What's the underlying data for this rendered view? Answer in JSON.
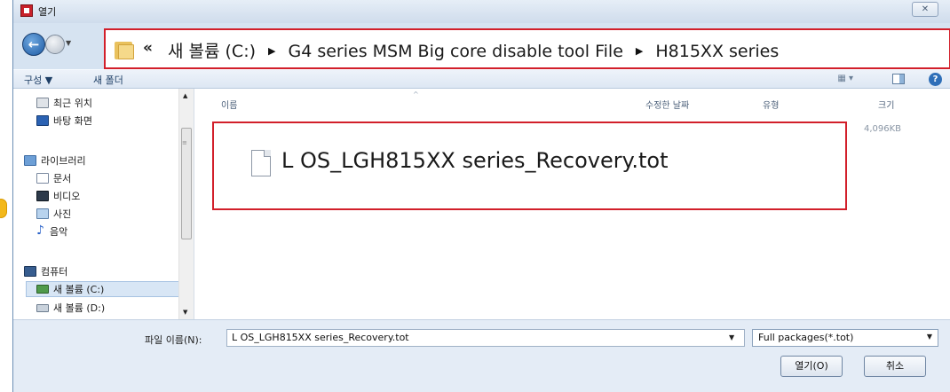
{
  "window": {
    "title": "열기"
  },
  "navigation": {
    "back_label": "←",
    "address_chevron": "«",
    "breadcrumb": [
      "새 볼륨 (C:)",
      "G4 series MSM Big core disable tool File",
      "H815XX series"
    ],
    "separator": "▶"
  },
  "toolbar": {
    "organize": "구성 ▼",
    "new_folder": "새 폴더",
    "view_label": "▦ ▾",
    "help_label": "?"
  },
  "sidebar": {
    "items": [
      {
        "label": "최근 위치",
        "icon": "recent-places-icon"
      },
      {
        "label": "바탕 화면",
        "icon": "desktop-icon"
      },
      {
        "label": "라이브러리",
        "icon": "libraries-icon"
      },
      {
        "label": "문서",
        "icon": "documents-icon"
      },
      {
        "label": "비디오",
        "icon": "videos-icon"
      },
      {
        "label": "사진",
        "icon": "pictures-icon"
      },
      {
        "label": "음악",
        "icon": "music-icon"
      },
      {
        "label": "컴퓨터",
        "icon": "computer-icon"
      },
      {
        "label": "새 볼륨 (C:)",
        "icon": "drive-c-icon"
      },
      {
        "label": "새 볼륨 (D:)",
        "icon": "drive-d-icon"
      }
    ]
  },
  "content": {
    "columns": [
      "이름",
      "수정한 날짜",
      "유형",
      "크기"
    ],
    "files": [
      {
        "name": "L OS_LGH815XX series_Recovery.tot",
        "size": "4,096KB"
      }
    ]
  },
  "footer": {
    "filename_label": "파일 이름(N):",
    "filename_value": "L OS_LGH815XX series_Recovery.tot",
    "filetype_value": "Full packages(*.tot)",
    "open_label": "열기(O)",
    "cancel_label": "취소"
  },
  "colors": {
    "highlight_border": "#d21f2a",
    "chrome": "#d6e3f1"
  }
}
